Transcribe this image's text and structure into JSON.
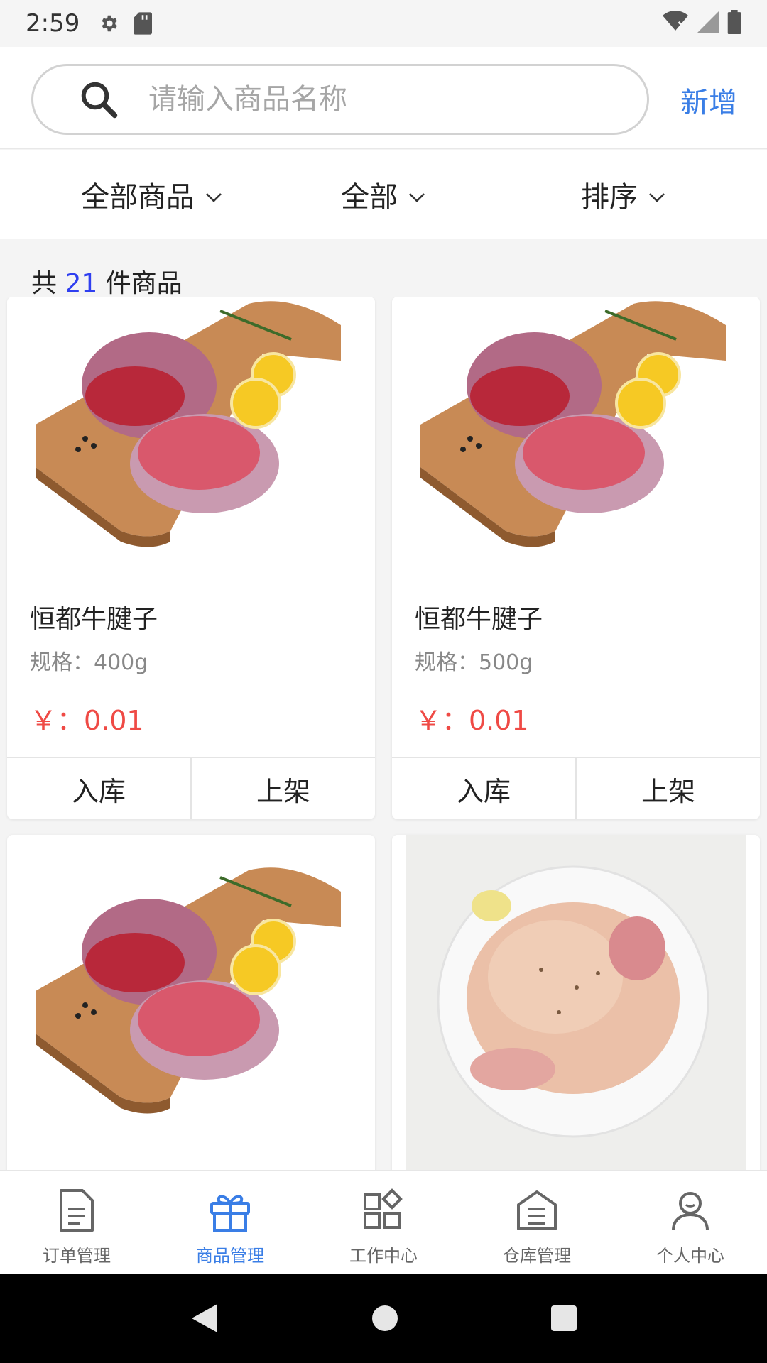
{
  "status_bar": {
    "time": "2:59",
    "icons": [
      "gear-icon",
      "sd-card-icon",
      "wifi-off-icon",
      "signal-icon",
      "battery-icon"
    ]
  },
  "search": {
    "placeholder": "请输入商品名称",
    "value": "",
    "add_label": "新增"
  },
  "filters": [
    {
      "label": "全部商品",
      "icon": "chevron-down-icon"
    },
    {
      "label": "全部",
      "icon": "chevron-down-icon"
    },
    {
      "label": "排序",
      "icon": "chevron-down-icon"
    }
  ],
  "count": {
    "prefix": "共",
    "number": "21",
    "suffix": "件商品"
  },
  "products": [
    {
      "name": "恒都牛腱子",
      "spec": "规格：400g",
      "price": "￥：0.01",
      "image": "beef-shank",
      "stock_label": "入库",
      "shelf_label": "上架"
    },
    {
      "name": "恒都牛腱子",
      "spec": "规格：500g",
      "price": "￥：0.01",
      "image": "beef-shank",
      "stock_label": "入库",
      "shelf_label": "上架"
    },
    {
      "image": "beef-shank"
    },
    {
      "image": "whole-chicken"
    }
  ],
  "tabs": [
    {
      "label": "订单管理",
      "icon": "document-icon",
      "active": false
    },
    {
      "label": "商品管理",
      "icon": "gift-icon",
      "active": true
    },
    {
      "label": "工作中心",
      "icon": "apps-icon",
      "active": false
    },
    {
      "label": "仓库管理",
      "icon": "warehouse-icon",
      "active": false
    },
    {
      "label": "个人中心",
      "icon": "person-icon",
      "active": false
    }
  ],
  "colors": {
    "accent": "#3a7ee6",
    "price": "#ef4a45",
    "count_number": "#2f3ff0"
  }
}
